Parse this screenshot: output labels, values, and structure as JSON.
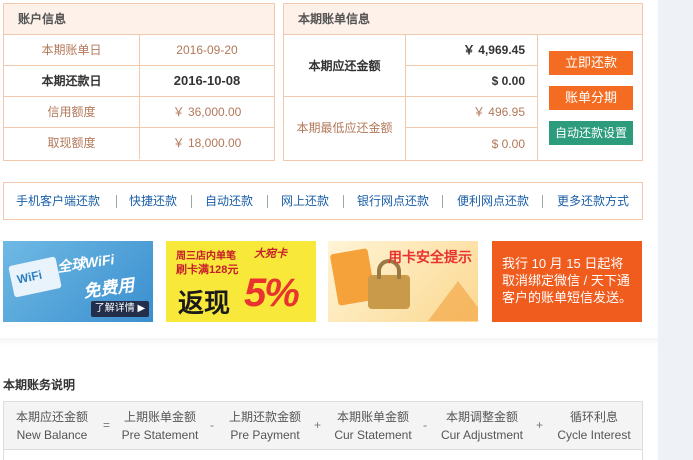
{
  "account": {
    "header": "账户信息",
    "rows": [
      {
        "label": "本期账单日",
        "value": "2016-09-20"
      },
      {
        "label": "本期还款日",
        "value": "2016-10-08"
      },
      {
        "label": "信用额度",
        "value": "￥ 36,000.00"
      },
      {
        "label": "取现额度",
        "value": "￥ 18,000.00"
      }
    ]
  },
  "bill": {
    "header": "本期账单信息",
    "due_label": "本期应还金额",
    "due_values": [
      "￥ 4,969.45",
      "$ 0.00"
    ],
    "min_label": "本期最低应还金额",
    "min_values": [
      "￥ 496.95",
      "$ 0.00"
    ],
    "buttons": [
      "立即还款",
      "账单分期",
      "自动还款设置"
    ]
  },
  "pay_methods": [
    "手机客户端还款",
    "快捷还款",
    "自动还款",
    "网上还款",
    "银行网点还款",
    "便利网点还款",
    "更多还款方式"
  ],
  "banners": {
    "wifi": {
      "title": "全球WiFi",
      "subtitle": "免费用",
      "badge": "WiFi",
      "cta": "了解详情 ▶"
    },
    "cashback": {
      "line1": "周三店内单笔",
      "line2": "刷卡满128元",
      "big": "返现",
      "percent": "5%",
      "tag": "大宛卡"
    },
    "security": {
      "title": "用卡安全提示"
    },
    "notice": {
      "text": "我行 10 月 15 日起将取消绑定微信 / 天下通客户的账单短信发送。"
    }
  },
  "statement": {
    "title": "本期账务说明",
    "columns": [
      {
        "cn": "本期应还金额",
        "en": "New Balance"
      },
      {
        "cn": "上期账单金额",
        "en": "Pre Statement"
      },
      {
        "cn": "上期还款金额",
        "en": "Pre Payment"
      },
      {
        "cn": "本期账单金额",
        "en": "Cur Statement"
      },
      {
        "cn": "本期调整金额",
        "en": "Cur Adjustment"
      },
      {
        "cn": "循环利息",
        "en": "Cycle Interest"
      }
    ],
    "operators": [
      "=",
      "-",
      "+",
      "-",
      "+"
    ]
  },
  "colors": {
    "accent": "#f36c21",
    "green": "#2c9c7c",
    "link": "#1a5fa8",
    "border": "#f2c9ad"
  }
}
